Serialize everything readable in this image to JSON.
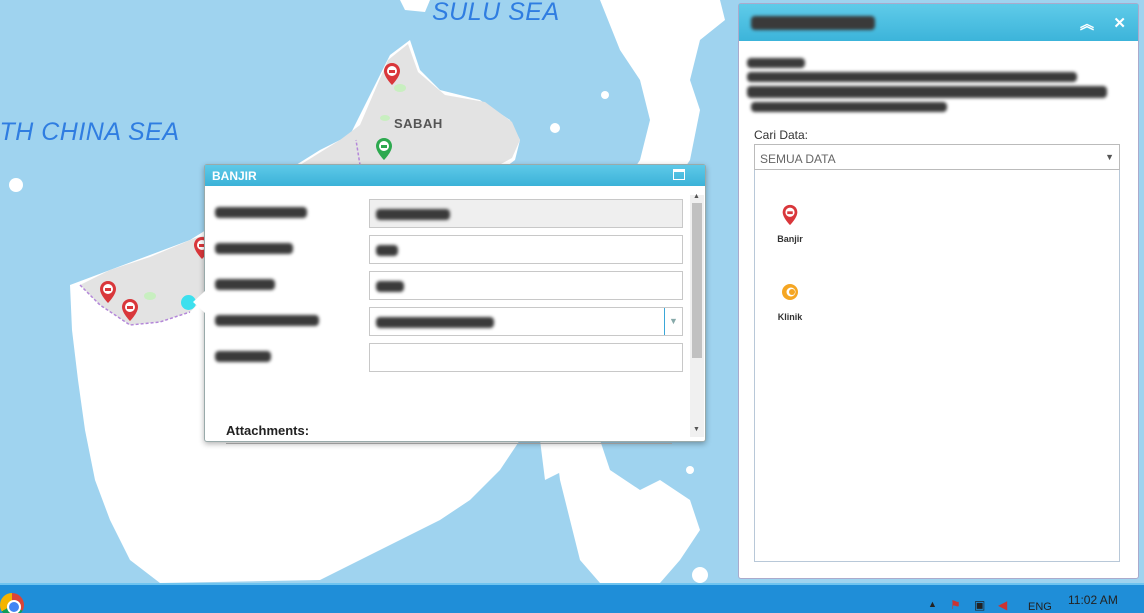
{
  "map": {
    "sea_labels": [
      "SULU SEA",
      "ITH CHINA SEA"
    ],
    "region_label": "SABAH"
  },
  "popup": {
    "title": "BANJIR",
    "attachments_label": "Attachments:"
  },
  "panel": {
    "cari_label": "Cari Data:",
    "cari_value": "SEMUA DATA",
    "items": [
      {
        "label": "Banjir",
        "icon": "flood-marker-icon",
        "color": "#d9373b"
      },
      {
        "label": "Klinik",
        "icon": "clinic-marker-icon",
        "color": "#f5a623"
      }
    ]
  },
  "taskbar": {
    "lang": "ENG",
    "time": "11:02 AM"
  },
  "colors": {
    "sea": "#9fd3ef",
    "land": "#ffffff",
    "header": "#3cb4da",
    "taskbar": "#1f8ed8"
  }
}
